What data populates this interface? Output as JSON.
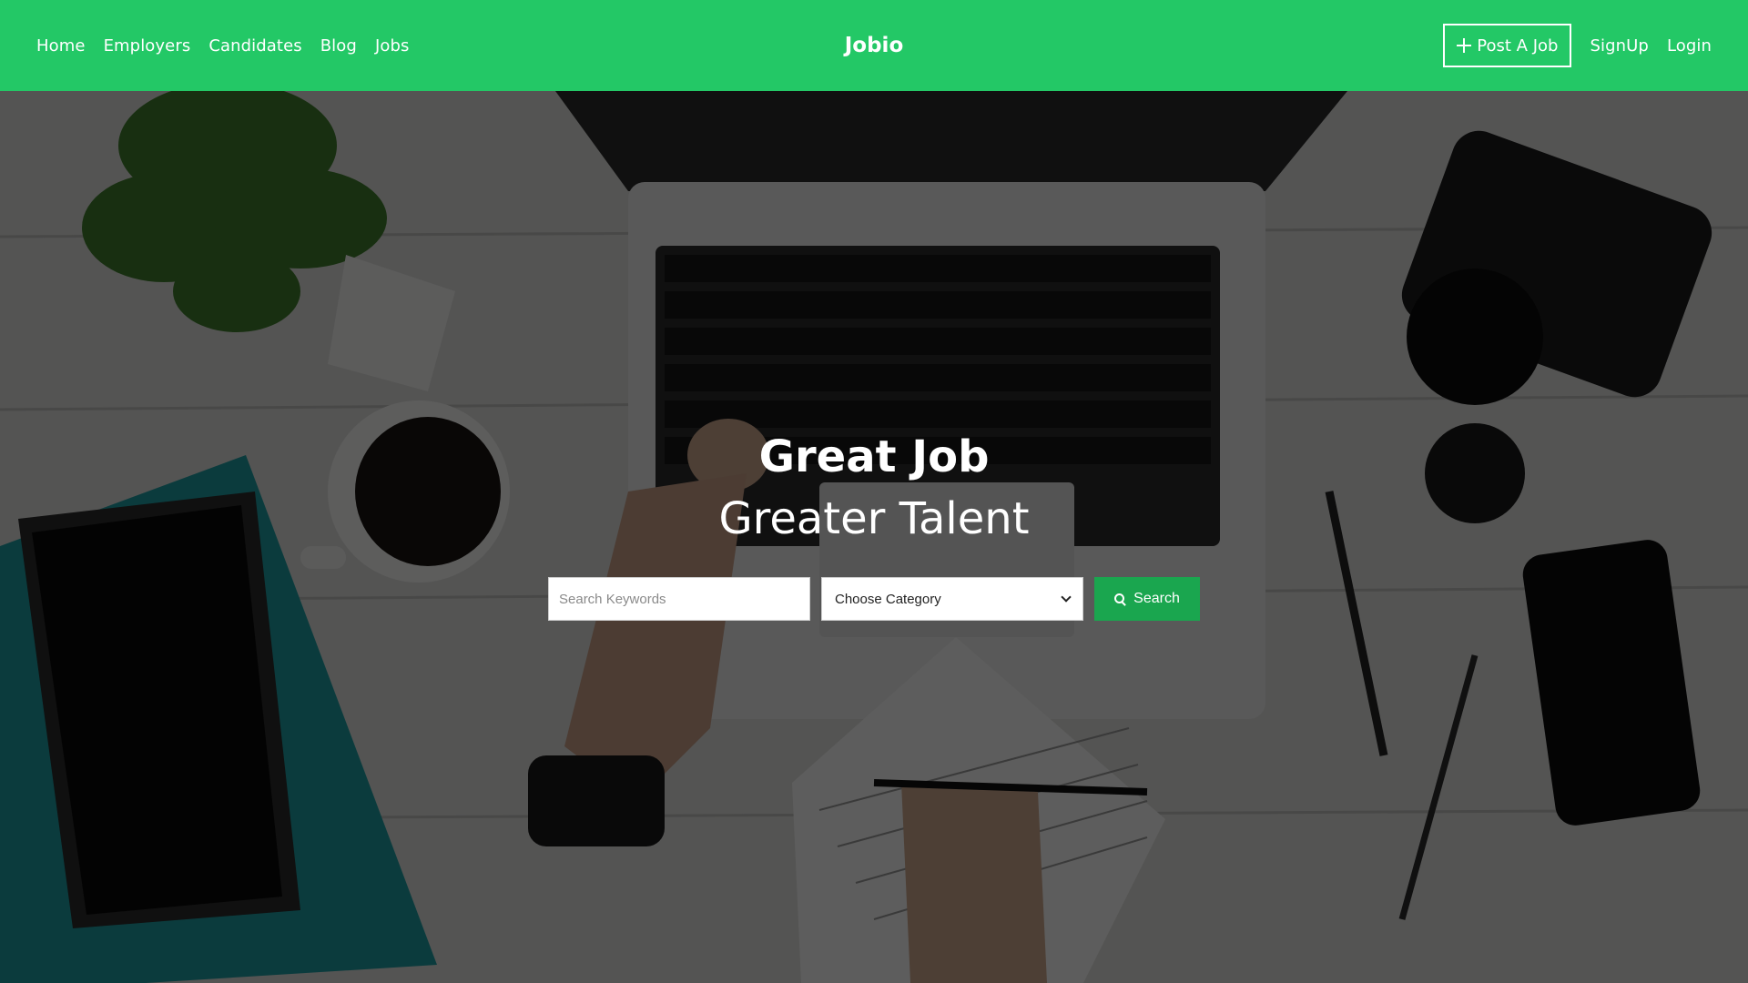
{
  "navbar": {
    "brand": "Jobio",
    "links": [
      "Home",
      "Employers",
      "Candidates",
      "Blog",
      "Jobs"
    ],
    "post_job_label": "Post A Job",
    "signup_label": "SignUp",
    "login_label": "Login"
  },
  "hero": {
    "headline": "Great Job",
    "subheadline": "Greater Talent",
    "search": {
      "keywords_placeholder": "Search Keywords",
      "keywords_value": "",
      "category_selected": "Choose Category",
      "button_label": "Search"
    }
  },
  "colors": {
    "nav_green": "#23c866",
    "button_green": "#1aa64f"
  },
  "icons": [
    "plus-icon",
    "search-icon",
    "chevron-down-icon"
  ]
}
